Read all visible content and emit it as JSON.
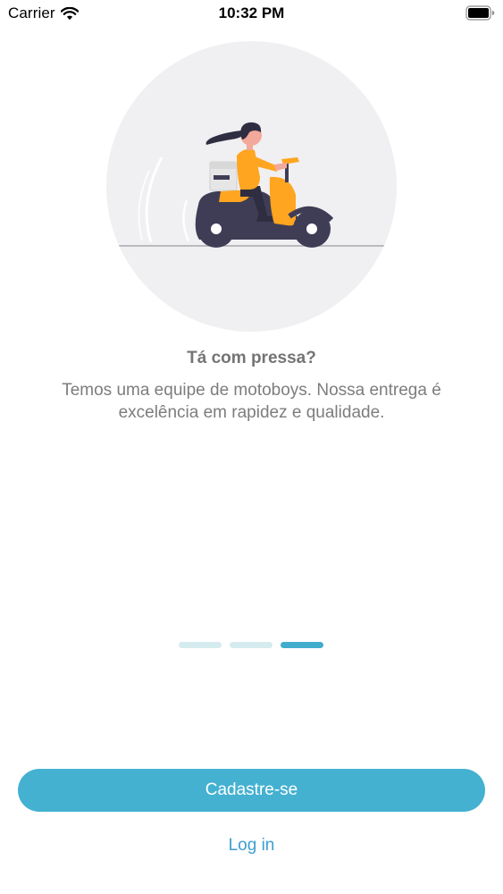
{
  "status_bar": {
    "carrier": "Carrier",
    "time": "10:32 PM"
  },
  "illustration": {
    "icon": "scooter-delivery-illustration",
    "circle_color": "#f0eff1",
    "accent_color": "#ffa51f",
    "dark_color": "#3f3d56"
  },
  "slide": {
    "title": "Tá com pressa?",
    "description": "Temos uma equipe de motoboys. Nossa entrega é excelência em rapidez e qualidade."
  },
  "pager": {
    "total": 3,
    "active_index": 2
  },
  "actions": {
    "signup_label": "Cadastre-se",
    "login_label": "Log in"
  },
  "colors": {
    "primary": "#44b1d1",
    "link": "#3d9ed0",
    "title": "#747474",
    "text": "#7d7d7d",
    "dot_inactive": "#d5ecef",
    "dot_active": "#41adcc"
  }
}
